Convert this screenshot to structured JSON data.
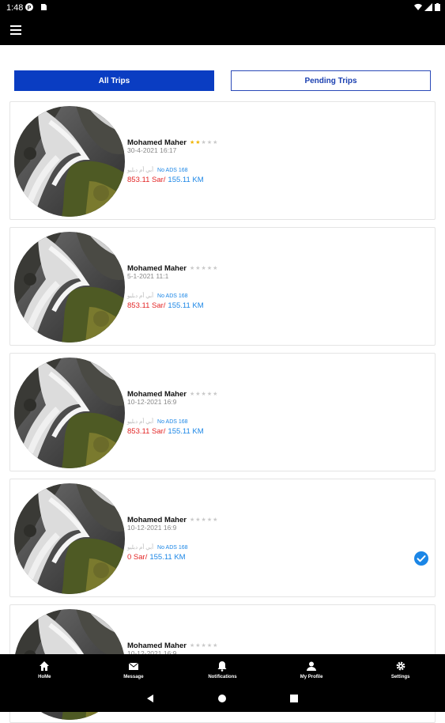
{
  "status_bar": {
    "time": "1:48"
  },
  "tabs": [
    {
      "label": "All Trips",
      "active": true
    },
    {
      "label": "Pending Trips",
      "active": false
    }
  ],
  "trips": [
    {
      "driver": "Mohamed Maher",
      "rating": 2,
      "date": "30-4-2021  16:17",
      "ads_arabic": "أبي أم دبليو",
      "ads_code": "No ADS 168",
      "price": "853.11 Sar/",
      "distance": "155.11 KM",
      "selected": false
    },
    {
      "driver": "Mohamed Maher",
      "rating": 0,
      "date": "5-1-2021  11:1",
      "ads_arabic": "أبي أم دبليو",
      "ads_code": "No ADS 168",
      "price": "853.11 Sar/",
      "distance": "155.11 KM",
      "selected": false
    },
    {
      "driver": "Mohamed Maher",
      "rating": 0,
      "date": "10-12-2021  16:9",
      "ads_arabic": "أبي أم دبليو",
      "ads_code": "No ADS 168",
      "price": "853.11 Sar/",
      "distance": "155.11 KM",
      "selected": false
    },
    {
      "driver": "Mohamed Maher",
      "rating": 0,
      "date": "10-12-2021  16:9",
      "ads_arabic": "أبي أم دبليو",
      "ads_code": "No ADS 168",
      "price": "0 Sar/",
      "distance": "155.11 KM",
      "selected": true
    },
    {
      "driver": "Mohamed Maher",
      "rating": 0,
      "date": "10-12-2021  16:9",
      "ads_arabic": "",
      "ads_code": "",
      "price": "",
      "distance": "",
      "selected": false
    }
  ],
  "bottom_nav": [
    {
      "label": "HoMe",
      "icon": "home-icon"
    },
    {
      "label": "Message",
      "icon": "mail-icon"
    },
    {
      "label": "Notifications",
      "icon": "bell-icon"
    },
    {
      "label": "My Profile",
      "icon": "person-icon"
    },
    {
      "label": "Settings",
      "icon": "gear-icon"
    }
  ],
  "colors": {
    "primary": "#0a3dc2",
    "price": "#e32626",
    "link": "#1b86e6",
    "star": "#f0b400"
  }
}
